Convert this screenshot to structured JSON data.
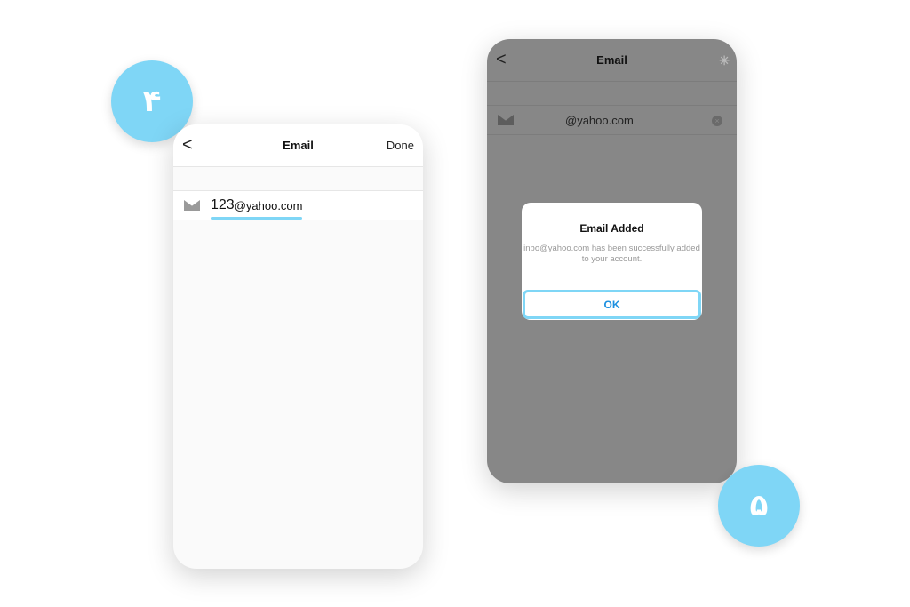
{
  "step4": {
    "badge": "۴",
    "title": "Email",
    "done": "Done",
    "back": "<",
    "prefix": "123",
    "domain": "@yahoo.com"
  },
  "step5": {
    "badge": "۵",
    "title": "Email",
    "back": "<",
    "email": "@yahoo.com",
    "dialog": {
      "title": "Email Added",
      "message": "inbo@yahoo.com has been successfully added to your account.",
      "ok": "OK"
    }
  },
  "colors": {
    "accent": "#7fd6f6",
    "link": "#1a8fe0",
    "overlay": "#878787"
  }
}
